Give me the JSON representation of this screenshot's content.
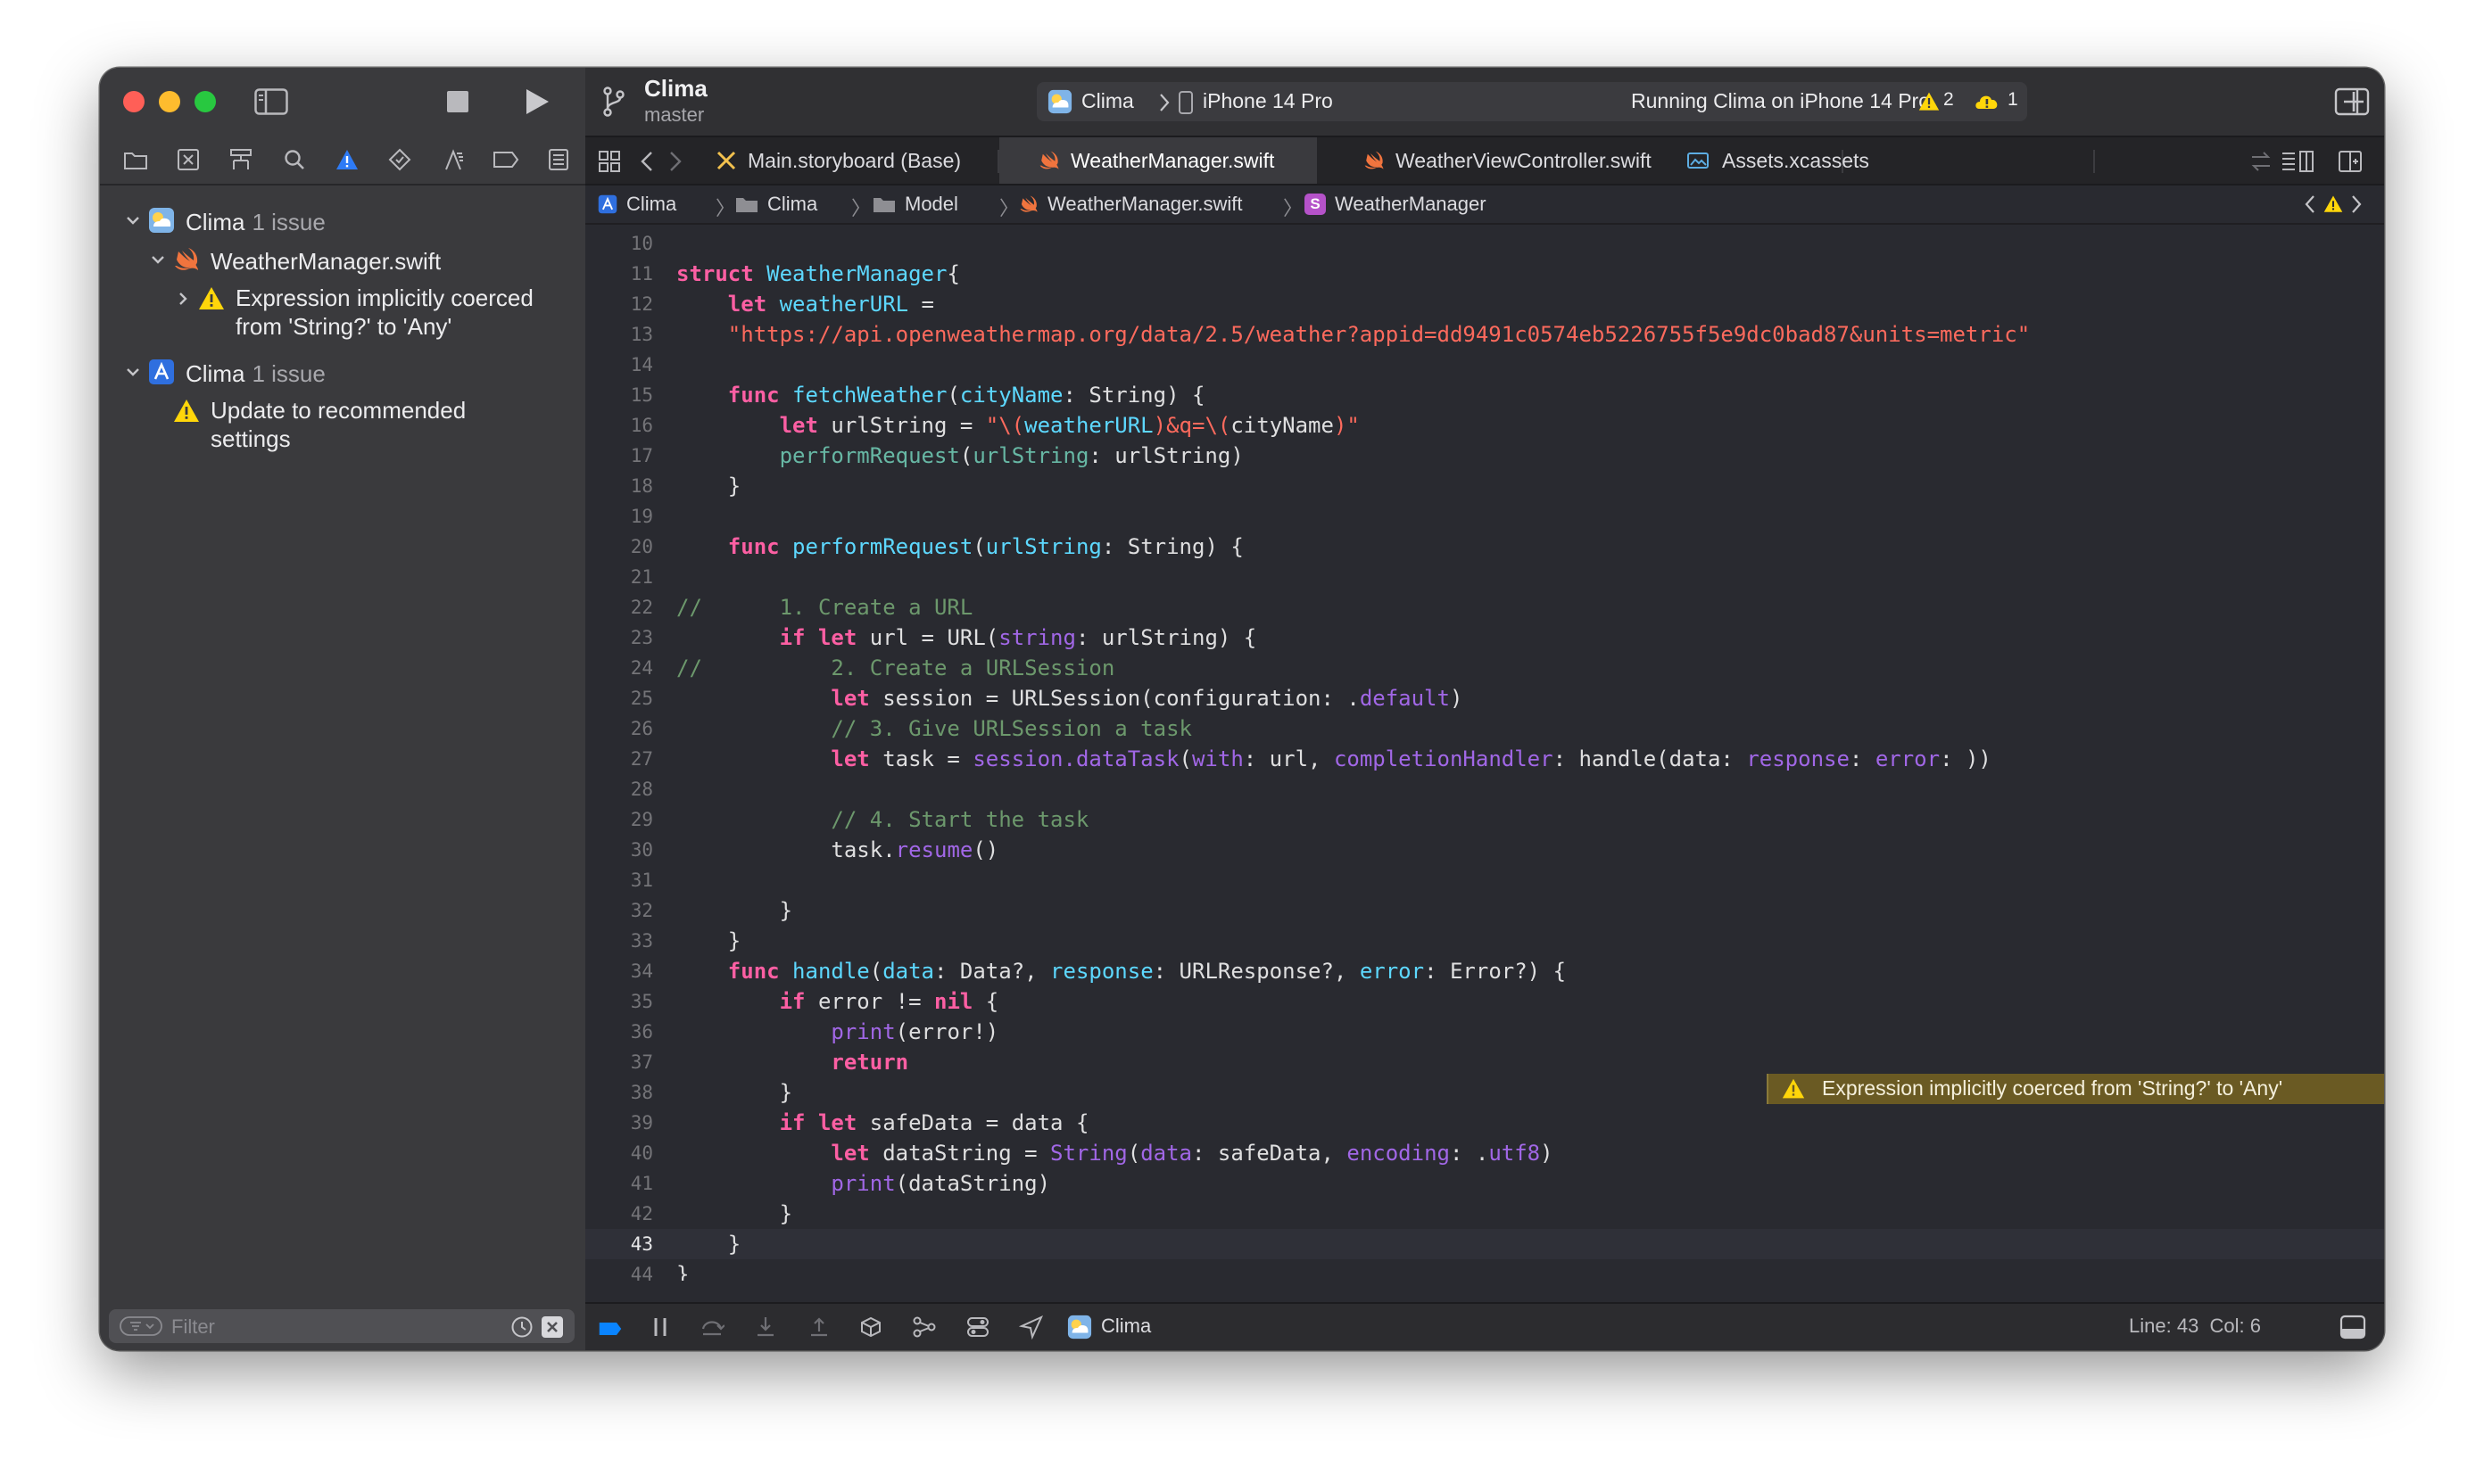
{
  "project": {
    "title": "Clima",
    "branch": "master"
  },
  "activity": {
    "scheme": "Clima",
    "device": "iPhone 14 Pro",
    "status": "Running Clima on iPhone 14 Pro",
    "warning_count": "2",
    "cloud_count": "1"
  },
  "tabs": [
    {
      "label": "Main.storyboard (Base)",
      "icon": "storyboard-icon"
    },
    {
      "label": "WeatherManager.swift",
      "icon": "swift-icon"
    },
    {
      "label": "WeatherViewController.swift",
      "icon": "swift-icon"
    },
    {
      "label": "Assets.xcassets",
      "icon": "assets-icon"
    }
  ],
  "jumpbar": {
    "items": [
      "Clima",
      "Clima",
      "Model",
      "WeatherManager.swift",
      "WeatherManager"
    ],
    "struct_badge": "S"
  },
  "sidebar": {
    "issues": [
      {
        "label": "Clima",
        "count": "1 issue"
      },
      {
        "label": "WeatherManager.swift"
      },
      {
        "label": "Expression implicitly coerced from 'String?' to 'Any'"
      },
      {
        "label": "Clima",
        "count": "1 issue"
      },
      {
        "label": "Update to recommended settings"
      }
    ],
    "filter_placeholder": "Filter"
  },
  "editor": {
    "warning_message": "Expression implicitly coerced from 'String?' to 'Any'",
    "current_line": 43,
    "lines": [
      {
        "n": "10",
        "tokens": []
      },
      {
        "n": "11",
        "tokens": [
          [
            "k",
            "struct "
          ],
          [
            "t",
            "WeatherManager"
          ],
          [
            "",
            "{"
          ]
        ]
      },
      {
        "n": "12",
        "tokens": [
          [
            "",
            "    "
          ],
          [
            "k",
            "let "
          ],
          [
            "t",
            "weatherURL"
          ],
          [
            "",
            " ="
          ]
        ]
      },
      {
        "n": "13",
        "tokens": [
          [
            "",
            "    "
          ],
          [
            "s",
            "\"https://api.openweathermap.org/data/2.5/weather?appid=dd9491c0574eb5226755f5e9dc0bad87&units=metric\""
          ]
        ]
      },
      {
        "n": "14",
        "tokens": []
      },
      {
        "n": "15",
        "tokens": [
          [
            "",
            "    "
          ],
          [
            "k",
            "func "
          ],
          [
            "t",
            "fetchWeather"
          ],
          [
            "",
            "("
          ],
          [
            "t",
            "cityName"
          ],
          [
            "",
            ": String) {"
          ]
        ]
      },
      {
        "n": "16",
        "tokens": [
          [
            "",
            "        "
          ],
          [
            "k",
            "let "
          ],
          [
            "",
            "urlString = "
          ],
          [
            "s",
            "\"\\("
          ],
          [
            "t",
            "weatherURL"
          ],
          [
            "s",
            ")&q=\\("
          ],
          [
            "",
            "cityName"
          ],
          [
            "s",
            ")\""
          ]
        ]
      },
      {
        "n": "17",
        "tokens": [
          [
            "",
            "        "
          ],
          [
            "f",
            "performRequest"
          ],
          [
            "",
            "("
          ],
          [
            "f",
            "urlString"
          ],
          [
            "",
            ": urlString)"
          ]
        ]
      },
      {
        "n": "18",
        "tokens": [
          [
            "",
            "    }"
          ]
        ]
      },
      {
        "n": "19",
        "tokens": []
      },
      {
        "n": "20",
        "tokens": [
          [
            "",
            "    "
          ],
          [
            "k",
            "func "
          ],
          [
            "t",
            "performRequest"
          ],
          [
            "",
            "("
          ],
          [
            "t",
            "urlString"
          ],
          [
            "",
            ": String) {"
          ]
        ]
      },
      {
        "n": "21",
        "tokens": []
      },
      {
        "n": "22",
        "tokens": [
          [
            "c",
            "//      1. Create a URL"
          ]
        ]
      },
      {
        "n": "23",
        "tokens": [
          [
            "",
            "        "
          ],
          [
            "k",
            "if let "
          ],
          [
            "",
            "url = URL("
          ],
          [
            "m",
            "string"
          ],
          [
            "",
            ": urlString) {"
          ]
        ]
      },
      {
        "n": "24",
        "tokens": [
          [
            "c",
            "//          2. Create a URLSession"
          ]
        ]
      },
      {
        "n": "25",
        "tokens": [
          [
            "",
            "            "
          ],
          [
            "k",
            "let "
          ],
          [
            "",
            "session = URLSession(configuration: ."
          ],
          [
            "m",
            "default"
          ],
          [
            "",
            ")"
          ]
        ]
      },
      {
        "n": "26",
        "tokens": [
          [
            "",
            "            "
          ],
          [
            "c",
            "// 3. Give URLSession a task"
          ]
        ]
      },
      {
        "n": "27",
        "tokens": [
          [
            "",
            "            "
          ],
          [
            "k",
            "let "
          ],
          [
            "",
            "task = "
          ],
          [
            "m",
            "session.dataTask"
          ],
          [
            "",
            "("
          ],
          [
            "m",
            "with"
          ],
          [
            "",
            ": url, "
          ],
          [
            "m",
            "completionHandler"
          ],
          [
            "",
            ": handle(data: "
          ],
          [
            "m",
            "response"
          ],
          [
            "",
            ": "
          ],
          [
            "m",
            "error"
          ],
          [
            "",
            ": ))"
          ]
        ]
      },
      {
        "n": "28",
        "tokens": []
      },
      {
        "n": "29",
        "tokens": [
          [
            "",
            "            "
          ],
          [
            "c",
            "// 4. Start the task"
          ]
        ]
      },
      {
        "n": "30",
        "tokens": [
          [
            "",
            "            task."
          ],
          [
            "m",
            "resume"
          ],
          [
            "",
            "()"
          ]
        ]
      },
      {
        "n": "31",
        "tokens": []
      },
      {
        "n": "32",
        "tokens": [
          [
            "",
            "        }"
          ]
        ]
      },
      {
        "n": "33",
        "tokens": [
          [
            "",
            "    }"
          ]
        ]
      },
      {
        "n": "34",
        "tokens": [
          [
            "",
            "    "
          ],
          [
            "k",
            "func "
          ],
          [
            "t",
            "handle"
          ],
          [
            "",
            "("
          ],
          [
            "t",
            "data"
          ],
          [
            "",
            ": Data?, "
          ],
          [
            "t",
            "response"
          ],
          [
            "",
            ": URLResponse?, "
          ],
          [
            "t",
            "error"
          ],
          [
            "",
            ": Error?) {"
          ]
        ]
      },
      {
        "n": "35",
        "tokens": [
          [
            "",
            "        "
          ],
          [
            "k",
            "if "
          ],
          [
            "",
            "error != "
          ],
          [
            "k",
            "nil "
          ],
          [
            "",
            "{"
          ]
        ]
      },
      {
        "n": "36",
        "tokens": [
          [
            "",
            "            "
          ],
          [
            "m",
            "print"
          ],
          [
            "",
            "(error!)"
          ]
        ]
      },
      {
        "n": "37",
        "tokens": [
          [
            "",
            "            "
          ],
          [
            "k",
            "return"
          ]
        ]
      },
      {
        "n": "38",
        "tokens": [
          [
            "",
            "        }"
          ]
        ]
      },
      {
        "n": "39",
        "tokens": [
          [
            "",
            "        "
          ],
          [
            "k",
            "if let "
          ],
          [
            "",
            "safeData = data {"
          ]
        ]
      },
      {
        "n": "40",
        "tokens": [
          [
            "",
            "            "
          ],
          [
            "k",
            "let "
          ],
          [
            "",
            "dataString = "
          ],
          [
            "m",
            "String"
          ],
          [
            "",
            "("
          ],
          [
            "m",
            "data"
          ],
          [
            "",
            ": safeData, "
          ],
          [
            "m",
            "encoding"
          ],
          [
            "",
            ": ."
          ],
          [
            "m",
            "utf8"
          ],
          [
            "",
            ")"
          ]
        ]
      },
      {
        "n": "41",
        "tokens": [
          [
            "",
            "            "
          ],
          [
            "m",
            "print"
          ],
          [
            "",
            "(dataString)"
          ]
        ]
      },
      {
        "n": "42",
        "tokens": [
          [
            "",
            "        }"
          ]
        ]
      },
      {
        "n": "43",
        "tokens": [
          [
            "",
            "    }"
          ]
        ]
      },
      {
        "n": "44",
        "tokens": [
          [
            "",
            "}"
          ]
        ]
      }
    ]
  },
  "statusbar": {
    "target": "Clima",
    "cursor": "Line: 43  Col: 6"
  },
  "colors": {
    "keyword": "#fc5fa3",
    "string": "#fc6a5d",
    "type": "#5dd8ff",
    "function": "#67b7a4",
    "member": "#a167e6",
    "comment": "#6c986c",
    "warning": "#ffd60a",
    "accent": "#0a84ff"
  }
}
